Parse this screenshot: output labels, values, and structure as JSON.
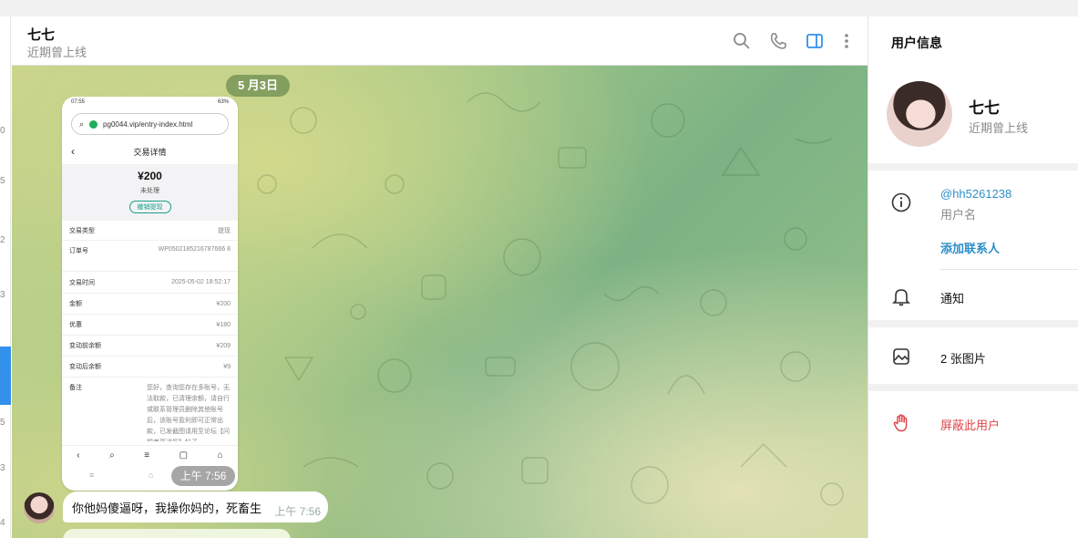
{
  "left_strip": {
    "labels": [
      "0",
      "5",
      "2",
      "3",
      "4",
      "5",
      "3",
      "4"
    ]
  },
  "chat": {
    "title": "七七",
    "status": "近期曾上线",
    "date_pill": "5 月3日",
    "header_icons": [
      "search-icon",
      "phone-icon",
      "sidebar-toggle-icon",
      "more-vertical-icon"
    ]
  },
  "screenshot": {
    "status_bar_left": "07:55",
    "status_bar_right": "63%",
    "url": "pg0044.vip/entry-index.html",
    "page_title": "交易详情",
    "amount": "¥200",
    "amount_status": "未处理",
    "cancel_label": "撤销提现",
    "rows": [
      {
        "label": "交易类型",
        "value": "提现"
      },
      {
        "label": "订单号",
        "value": "WP0502185216787666 8"
      },
      {
        "label": "交易时间",
        "value": "2025-05-02 18:52:17"
      },
      {
        "label": "金额",
        "value": "¥200"
      },
      {
        "label": "优惠",
        "value": "¥180"
      },
      {
        "label": "变动前余额",
        "value": "¥209"
      },
      {
        "label": "变动后余额",
        "value": "¥9"
      }
    ],
    "note_label": "备注",
    "note_text": "您好，查询您存在多账号，无法取款，已清理余额，请自行或联系管理员删除其他账号后，该账号盈利即可正常出款，已发截图请用至论坛【问题老哥通报】帖子...",
    "time": "上午 7:56"
  },
  "message": {
    "text": "你他妈傻逼呀，我操你妈的，死畜生",
    "time": "上午 7:56"
  },
  "panel": {
    "title": "用户信息",
    "name": "七七",
    "status": "近期曾上线",
    "username": "@hh5261238",
    "username_caption": "用户名",
    "add_contact": "添加联系人",
    "notifications": "通知",
    "photos": "2 张图片",
    "block": "屏蔽此用户"
  },
  "colors": {
    "accent": "#3390ec",
    "link": "#2f8fc8",
    "danger": "#e0474c",
    "date_pill": "#6e8c50"
  }
}
